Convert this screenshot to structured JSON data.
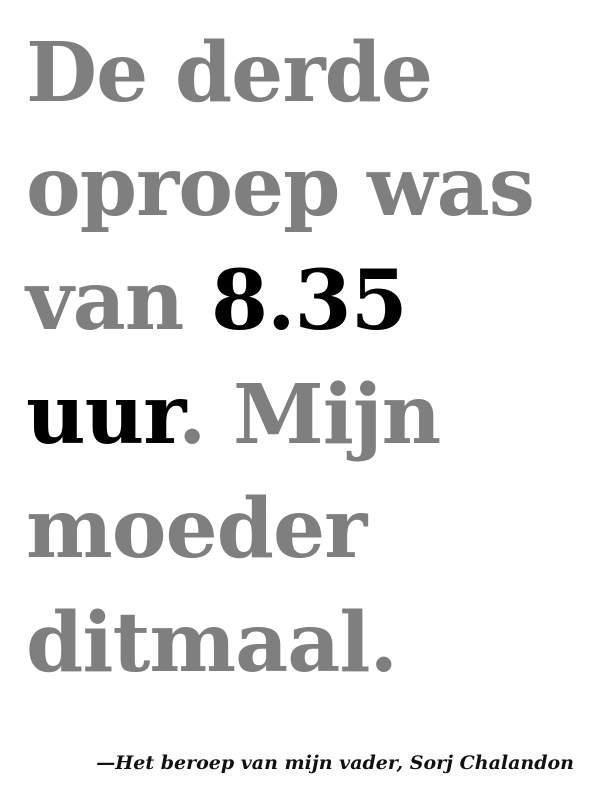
{
  "quote": {
    "line1": "De derde",
    "line2": "oproep was",
    "line3_pre": "van ",
    "line3_emph": "8.35",
    "line4_emph": "uur",
    "line4_post": ". Mijn",
    "line5": "moeder",
    "line6": "ditmaal."
  },
  "attribution": "—Het beroep van mijn vader, Sorj Chalandon",
  "colors": {
    "text_gray": "#7f7f7f",
    "text_emphasis": "#000000",
    "background": "#ffffff"
  }
}
